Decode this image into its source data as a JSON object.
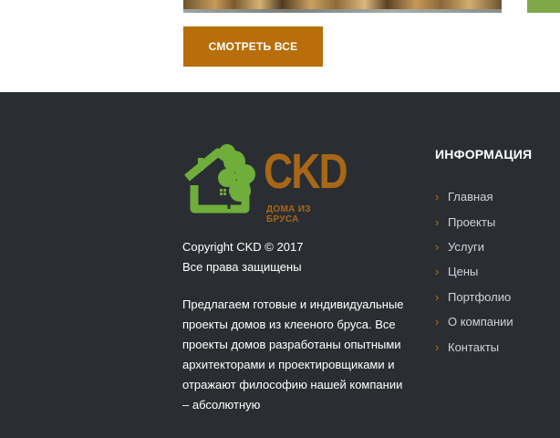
{
  "hero": {
    "button_label": "СМОТРЕТЬ ВСЕ"
  },
  "footer": {
    "logo": {
      "text": "CKD",
      "subtitle": "ДОМА ИЗ БРУСА",
      "colors": {
        "green": "#6fae3a",
        "brown": "#a86716"
      }
    },
    "copyright_line1": "Copyright CKD © 2017",
    "copyright_line2": "Все права защищены",
    "description": "Предлагаем готовые и индивидуальные проекты домов из клееного бруса. Все проекты домов разработаны опытными архитекторами и проектировщиками и отражают философию нашей компании – абсолютную",
    "info_title": "ИНФОРМАЦИЯ",
    "nav_items": [
      {
        "label": "Главная"
      },
      {
        "label": "Проекты"
      },
      {
        "label": "Услуги"
      },
      {
        "label": "Цены"
      },
      {
        "label": "Портфолио"
      },
      {
        "label": "О компании"
      },
      {
        "label": "Контакты"
      }
    ]
  },
  "colors": {
    "footer_bg": "#2a2e33",
    "accent": "#b86e0a"
  }
}
